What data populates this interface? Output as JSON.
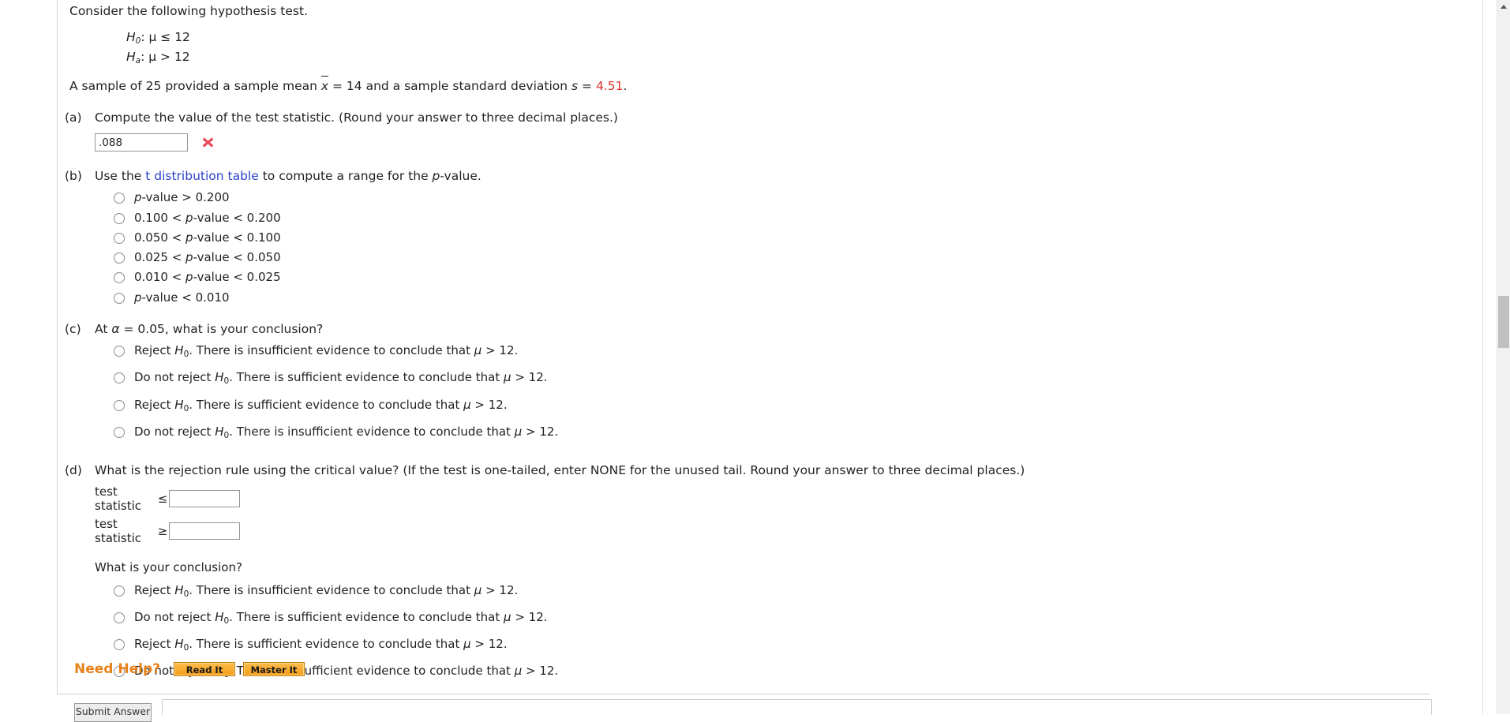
{
  "problem": {
    "intro": "Consider the following hypothesis test.",
    "hypotheses": [
      {
        "name": "H",
        "sub": "0",
        "relation": ": μ ≤ 12"
      },
      {
        "name": "H",
        "sub": "a",
        "relation": ": μ > 12"
      }
    ],
    "sample_statement": {
      "prefix": "A sample of 25 provided a sample mean ",
      "xbar": "x",
      "middle": " = 14 and a sample standard deviation ",
      "s_symbol": "s",
      "equals": " = ",
      "s_value": "4.51",
      "suffix": "."
    },
    "s_value_color": "#e03030"
  },
  "parts": {
    "a": {
      "letter": "(a)",
      "question": "Compute the value of the test statistic. (Round your answer to three decimal places.)",
      "answer_value": ".088",
      "answer_placeholder": "",
      "status_icon": "incorrect-x-icon",
      "status_color": "#e8495a"
    },
    "b": {
      "letter": "(b)",
      "question_prefix": "Use the ",
      "link_text": "t distribution table",
      "link_color": "#2a43c9",
      "question_suffix": " to compute a range for the p-value.",
      "options": [
        "p-value > 0.200",
        "0.100 < p-value < 0.200",
        "0.050 < p-value < 0.100",
        "0.025 < p-value < 0.050",
        "0.010 < p-value < 0.025",
        "p-value < 0.010"
      ]
    },
    "c": {
      "letter": "(c)",
      "question": "At α = 0.05, what is your conclusion?",
      "options": [
        "Reject H0. There is insufficient evidence to conclude that μ > 12.",
        "Do not reject H0. There is sufficient evidence to conclude that μ > 12.",
        "Reject H0. There is sufficient evidence to conclude that μ > 12.",
        "Do not reject H0. There is insufficient evidence to conclude that μ > 12."
      ]
    },
    "d": {
      "letter": "(d)",
      "question": "What is the rejection rule using the critical value? (If the test is one-tailed, enter NONE for the unused tail. Round your answer to three decimal places.)",
      "criteria": [
        {
          "label": "test statistic",
          "operator": "≤",
          "value": ""
        },
        {
          "label": "test statistic",
          "operator": "≥",
          "value": ""
        }
      ],
      "subquestion": "What is your conclusion?",
      "options": [
        "Reject H0. There is insufficient evidence to conclude that μ > 12.",
        "Do not reject H0. There is sufficient evidence to conclude that μ > 12.",
        "Reject H0. There is sufficient evidence to conclude that μ > 12.",
        "Do not reject H0. There is insufficient evidence to conclude that μ > 12."
      ]
    }
  },
  "help": {
    "label": "Need Help?",
    "label_color": "#e8821a",
    "buttons": [
      "Read It",
      "Master It"
    ]
  },
  "footer": {
    "submit_label": "Submit Answer"
  },
  "scrollbar": {
    "up_arrow_icon": "scroll-up-arrow-icon",
    "thumb_color": "#c0c0c0"
  }
}
